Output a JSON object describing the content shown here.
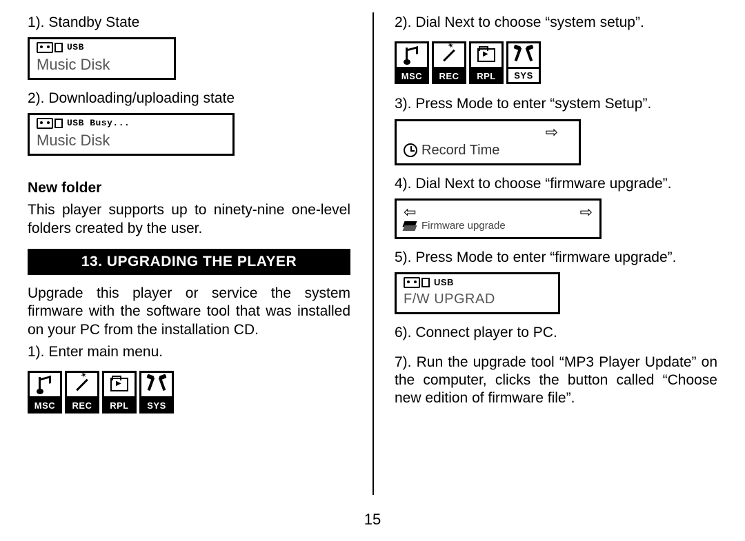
{
  "page_number": "15",
  "left": {
    "step1": "1). Standby State",
    "lcd_usb": {
      "badge": "USB",
      "title": "Music Disk"
    },
    "step2": "2). Downloading/uploading state",
    "lcd_busy": {
      "badge": "USB Busy...",
      "title": "Music Disk"
    },
    "newfolder_label": "New folder",
    "newfolder_text": "This player supports up to ninety-nine one-level folders created by the user.",
    "section_title": "13. UPGRADING THE PLAYER",
    "upgrade_text": "Upgrade this player or service the system firmware with the software tool that was installed on your PC from the installation CD.",
    "enter_main": "1). Enter main menu.",
    "menu": [
      "MSC",
      "REC",
      "RPL",
      "SYS"
    ]
  },
  "right": {
    "step2": "2). Dial Next to choose “system setup”.",
    "menu": [
      "MSC",
      "REC",
      "RPL",
      "SYS"
    ],
    "step3": "3). Press Mode to enter “system Setup”.",
    "recordtime_label": "Record Time",
    "step4": "4). Dial Next to choose “firmware upgrade”.",
    "fwbox_label": "Firmware upgrade",
    "step5": "5). Press Mode to enter “firmware upgrade”.",
    "fwupgrad_badge": "USB",
    "fwupgrad_title": "F/W UPGRAD",
    "step6": "6). Connect player to PC.",
    "step7": "7). Run the upgrade tool “MP3 Player Update” on the computer, clicks the button called “Choose new edition of firmware file”."
  }
}
